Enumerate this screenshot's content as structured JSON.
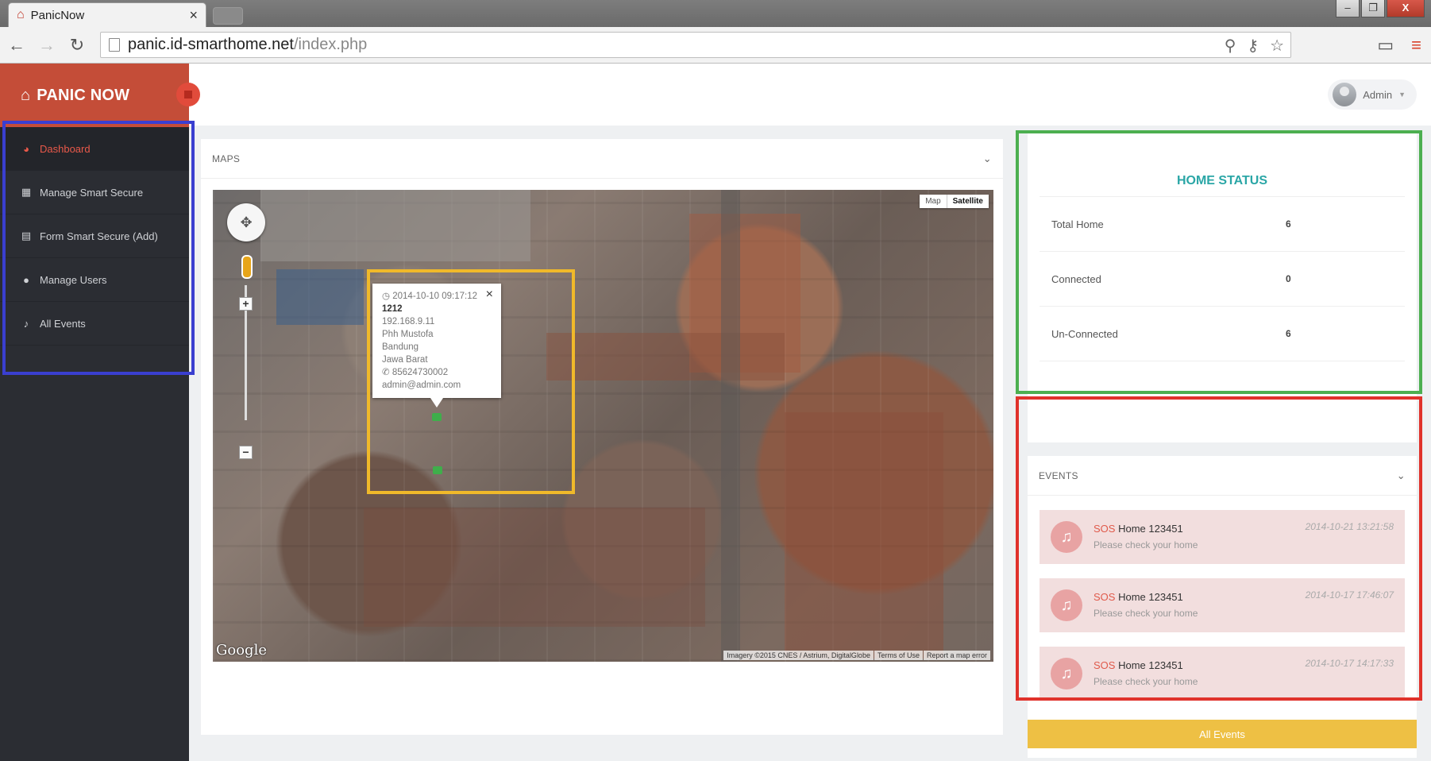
{
  "browser": {
    "tab_title": "PanicNow",
    "tab_close": "×",
    "url_host": "panic.id-smarthome.net",
    "url_path": "/index.php",
    "window_buttons": [
      "–",
      "❐",
      "X"
    ]
  },
  "app": {
    "brand": "PANIC NOW",
    "user": "Admin"
  },
  "sidebar": {
    "items": [
      {
        "label": "Dashboard",
        "icon": "dashboard-icon",
        "glyph": "◕",
        "active": true
      },
      {
        "label": "Manage Smart Secure",
        "icon": "grid-icon",
        "glyph": "▦",
        "active": false
      },
      {
        "label": "Form Smart Secure (Add)",
        "icon": "form-icon",
        "glyph": "▤",
        "active": false
      },
      {
        "label": "Manage Users",
        "icon": "user-icon",
        "glyph": "●",
        "active": false
      },
      {
        "label": "All Events",
        "icon": "bell-icon",
        "glyph": "♪",
        "active": false
      }
    ]
  },
  "maps": {
    "title": "MAPS",
    "map_type": [
      "Map",
      "Satellite"
    ],
    "selected_map_type": "Satellite",
    "logo": "Google",
    "attribution": [
      "Imagery ©2015 CNES / Astrium, DigitalGlobe",
      "Terms of Use",
      "Report a map error"
    ],
    "infowindow": {
      "timestamp": "2014-10-10 09:17:12",
      "code": "1212",
      "ip": "192.168.9.11",
      "name": "Phh Mustofa",
      "city": "Bandung",
      "province": "Jawa Barat",
      "phone": "85624730002",
      "email": "admin@admin.com"
    }
  },
  "home_status": {
    "title": "HOME STATUS",
    "rows": [
      {
        "label": "Total Home",
        "value": "6"
      },
      {
        "label": "Connected",
        "value": "0"
      },
      {
        "label": "Un-Connected",
        "value": "6"
      }
    ]
  },
  "events": {
    "title": "EVENTS",
    "items": [
      {
        "type": "SOS",
        "home": "Home 123451",
        "message": "Please check your home",
        "time": "2014-10-21 13:21:58"
      },
      {
        "type": "SOS",
        "home": "Home 123451",
        "message": "Please check your home",
        "time": "2014-10-17 17:46:07"
      },
      {
        "type": "SOS",
        "home": "Home 123451",
        "message": "Please check your home",
        "time": "2014-10-17 14:17:33"
      }
    ],
    "all_events_label": "All Events"
  },
  "colors": {
    "brand_red": "#c44d38",
    "sidebar_dark": "#2b2d33",
    "teal": "#2aa6a6",
    "event_bg": "#f2dede",
    "button_yellow": "#eec044",
    "highlight_blue": "#3a3fd0",
    "highlight_yellow": "#f0b92a",
    "highlight_green": "#4caf50",
    "highlight_red": "#e0322b"
  }
}
